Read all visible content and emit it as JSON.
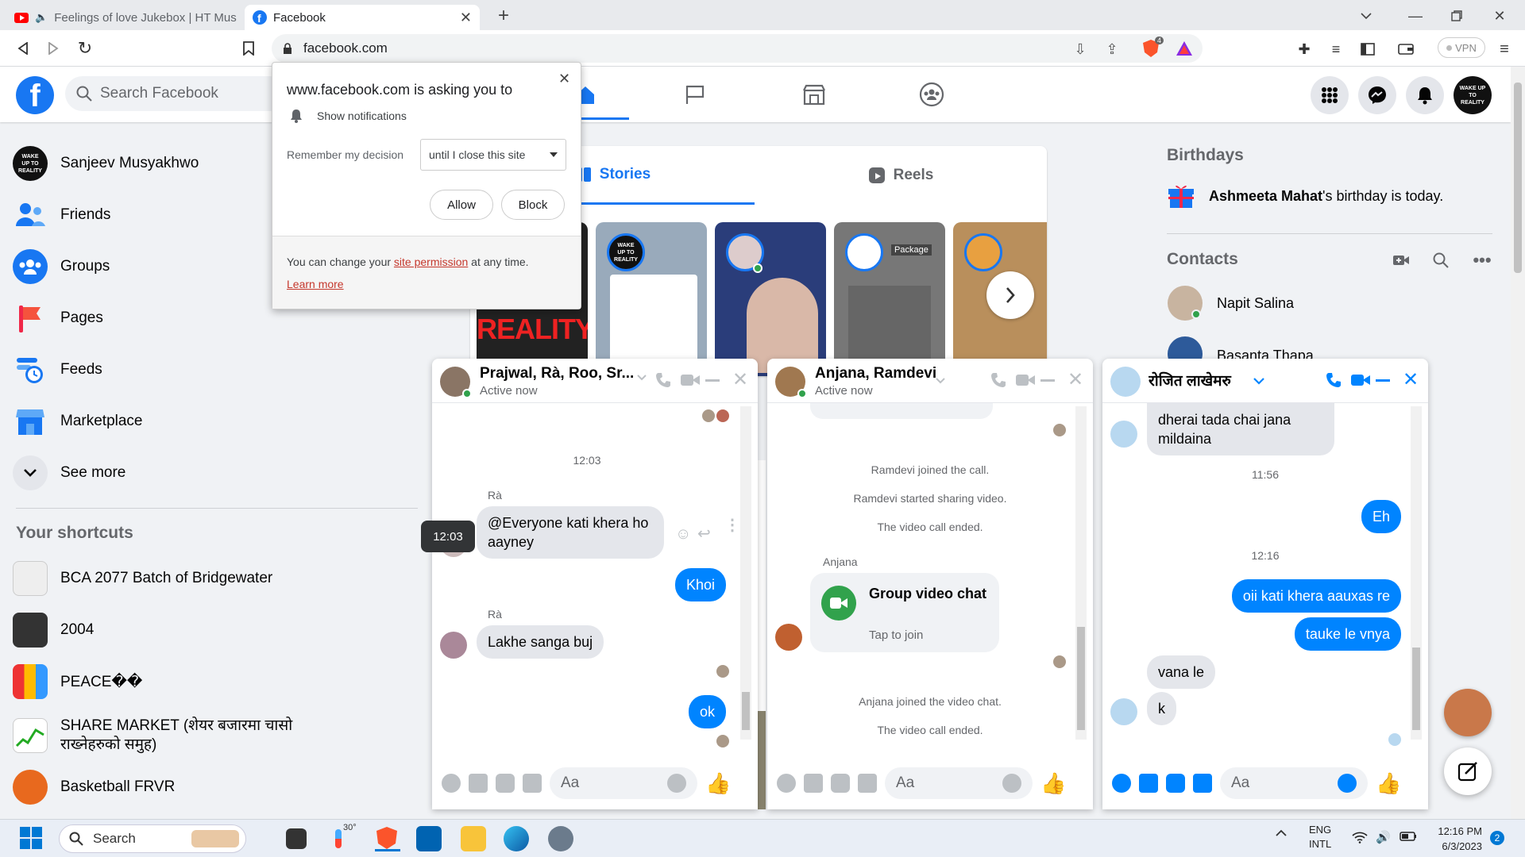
{
  "browser": {
    "tabs": [
      {
        "title": "Feelings of love Jukebox | HT Musi"
      },
      {
        "title": "Facebook"
      }
    ],
    "url": "facebook.com",
    "vpn_label": "VPN",
    "brave_badge": "4"
  },
  "fb": {
    "logo_letter": "f",
    "search_placeholder": "Search Facebook",
    "profile_badge": "WAKE UP TO REALITY"
  },
  "left_sidebar": {
    "items": [
      {
        "label": "Sanjeev Musyakhwo",
        "icon": "profile-avatar"
      },
      {
        "label": "Friends",
        "icon": "friends-icon"
      },
      {
        "label": "Groups",
        "icon": "groups-icon"
      },
      {
        "label": "Pages",
        "icon": "pages-flag-icon"
      },
      {
        "label": "Feeds",
        "icon": "feeds-clock-icon"
      },
      {
        "label": "Marketplace",
        "icon": "marketplace-icon"
      },
      {
        "label": "See more",
        "icon": "chevron-down-icon"
      }
    ],
    "shortcuts_title": "Your shortcuts",
    "shortcuts": [
      {
        "label": "BCA 2077 Batch of Bridgewater"
      },
      {
        "label": "2004"
      },
      {
        "label": "PEACE��"
      },
      {
        "label": "SHARE MARKET (शेयर बजारमा चासो राख्नेहरुको समुह)"
      },
      {
        "label": "Basketball FRVR"
      }
    ]
  },
  "stories": {
    "tabs": [
      {
        "label": "Stories"
      },
      {
        "label": "Reels"
      }
    ],
    "tile_texts": {
      "reality": "REALITY",
      "package": "Package"
    }
  },
  "right_sidebar": {
    "birthdays_title": "Birthdays",
    "birthday_name": "Ashmeeta Mahat",
    "birthday_text": "'s birthday is today.",
    "contacts_title": "Contacts",
    "contacts": [
      {
        "name": "Napit Salina"
      },
      {
        "name": "Basanta Thapa"
      }
    ]
  },
  "popup": {
    "title": "www.facebook.com is asking you to",
    "permission": "Show notifications",
    "remember_label": "Remember my decision",
    "remember_value": "until I close this site",
    "allow": "Allow",
    "block": "Block",
    "footer_pre": "You can change your ",
    "footer_link": "site permission",
    "footer_post": " at any time.",
    "learn_more": "Learn more"
  },
  "chats": [
    {
      "title": "Prajwal, Rà, Roo, Sr...",
      "status": "Active now",
      "time": "12:03",
      "tooltip": "12:03",
      "sender1": "Rà",
      "msg1": "@Everyone kati khera ho aayney",
      "me1": "Khoi",
      "sender2": "Rà",
      "msg2": "Lakhe sanga buj",
      "me2": "ok",
      "input_placeholder": "Aa"
    },
    {
      "title": "Anjana, Ramdevi",
      "status": "Active now",
      "sys1": "Ramdevi joined the call.",
      "sys2": "Ramdevi started sharing video.",
      "sys3": "The video call ended.",
      "sender": "Anjana",
      "card_title": "Group video chat",
      "card_sub": "Tap to join",
      "sys4": "Anjana joined the video chat.",
      "sys5": "The video call ended.",
      "input_placeholder": "Aa"
    },
    {
      "title": "रोजित लाखेमरु",
      "msg_top": "dherai tada  chai jana mildaina",
      "time1": "11:56",
      "me1": "Eh",
      "time2": "12:16",
      "me2": "oii kati khera aauxas re",
      "me3": "tauke le vnya",
      "them1": "vana le",
      "them2": "k",
      "input_placeholder": "Aa"
    }
  ],
  "taskbar": {
    "search": "Search",
    "weather": "30°",
    "lang1": "ENG",
    "lang2": "INTL",
    "time": "12:16 PM",
    "date": "6/3/2023",
    "notif": "2"
  },
  "colors": {
    "fb_blue": "#1877f2",
    "messenger_blue": "#0084ff",
    "brave_orange": "#fb542b"
  }
}
